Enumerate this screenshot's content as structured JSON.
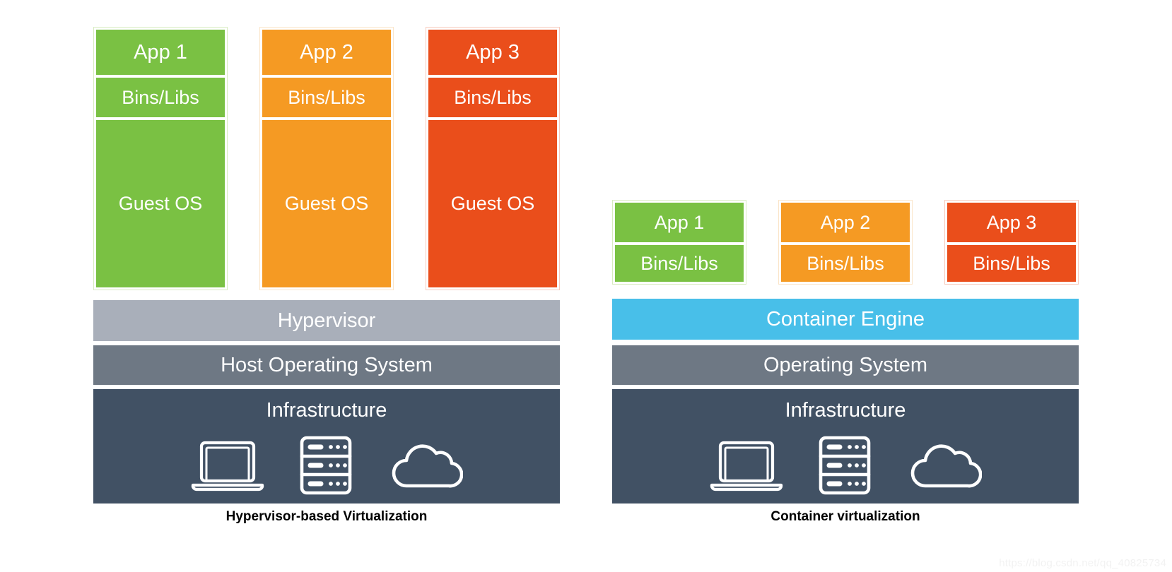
{
  "colors": {
    "green": "#7ac143",
    "orange": "#f59a23",
    "red": "#ea4e1b",
    "hypervisor_gray": "#a9afba",
    "os_gray": "#6e7884",
    "infrastructure_navy": "#415164",
    "container_engine_blue": "#48bfe9",
    "background": "#ffffff",
    "caption_text": "#000000"
  },
  "left_panel": {
    "caption": "Hypervisor-based Virtualization",
    "columns": [
      {
        "color": "green",
        "app": "App 1",
        "bins": "Bins/Libs",
        "guest_os": "Guest OS"
      },
      {
        "color": "orange",
        "app": "App 2",
        "bins": "Bins/Libs",
        "guest_os": "Guest OS"
      },
      {
        "color": "red",
        "app": "App 3",
        "bins": "Bins/Libs",
        "guest_os": "Guest OS"
      }
    ],
    "bands": {
      "hypervisor": "Hypervisor",
      "host_os": "Host Operating System",
      "infrastructure": "Infrastructure"
    },
    "infrastructure_icons": [
      "laptop-icon",
      "server-rack-icon",
      "cloud-icon"
    ]
  },
  "right_panel": {
    "caption": "Container virtualization",
    "columns": [
      {
        "color": "green",
        "app": "App 1",
        "bins": "Bins/Libs"
      },
      {
        "color": "orange",
        "app": "App 2",
        "bins": "Bins/Libs"
      },
      {
        "color": "red",
        "app": "App 3",
        "bins": "Bins/Libs"
      }
    ],
    "bands": {
      "container_engine": "Container Engine",
      "operating_system": "Operating System",
      "infrastructure": "Infrastructure"
    },
    "infrastructure_icons": [
      "laptop-icon",
      "server-rack-icon",
      "cloud-icon"
    ]
  },
  "watermark": "https://blog.csdn.net/qq_40825734"
}
